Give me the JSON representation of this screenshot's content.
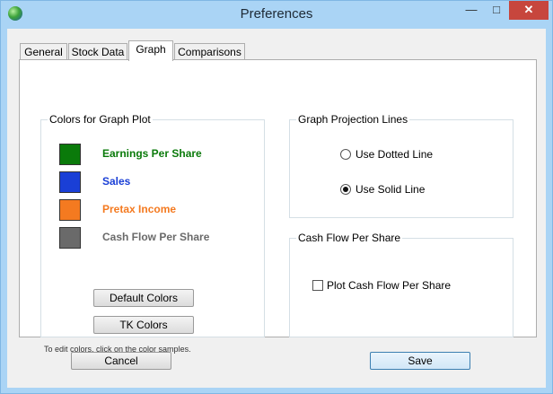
{
  "window": {
    "title": "Preferences"
  },
  "tabs": [
    {
      "label": "General"
    },
    {
      "label": "Stock Data"
    },
    {
      "label": "Graph"
    },
    {
      "label": "Comparisons"
    }
  ],
  "colors_group": {
    "title": "Colors for Graph Plot",
    "items": [
      {
        "label": "Earnings Per Share",
        "color": "#0a7a0a"
      },
      {
        "label": "Sales",
        "color": "#1a3fd6"
      },
      {
        "label": "Pretax Income",
        "color": "#f47a20"
      },
      {
        "label": "Cash Flow Per Share",
        "color": "#6a6a6a"
      }
    ],
    "default_button": "Default Colors",
    "tk_button": "TK Colors",
    "hint": "To edit colors, click on the color samples."
  },
  "projection_group": {
    "title": "Graph Projection Lines",
    "options": [
      {
        "label": "Use Dotted Line",
        "selected": false
      },
      {
        "label": "Use Solid Line",
        "selected": true
      }
    ]
  },
  "cash_group": {
    "title": "Cash Flow Per Share",
    "checkbox_label": "Plot Cash Flow Per Share",
    "checked": false
  },
  "footer": {
    "cancel_label": "Cancel",
    "save_label": "Save"
  }
}
